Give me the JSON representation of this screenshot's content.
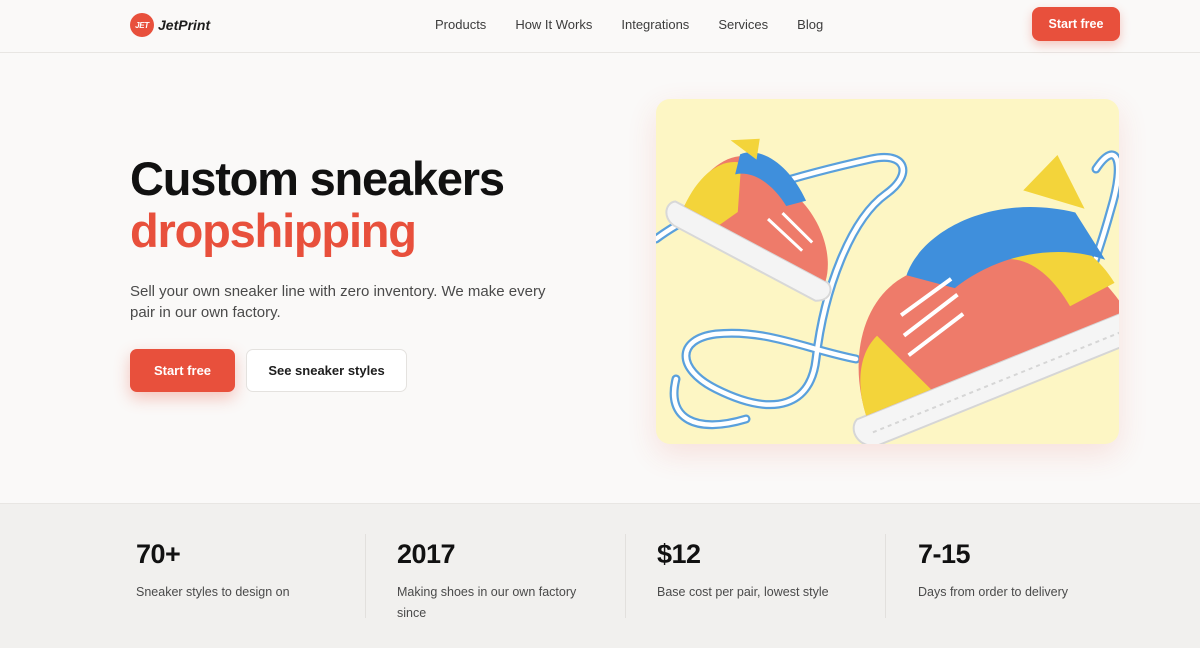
{
  "brand": {
    "name": "JetPrint",
    "mark": "JET"
  },
  "nav": {
    "items": [
      "Products",
      "How It Works",
      "Integrations",
      "Services",
      "Blog"
    ],
    "cta": "Start free"
  },
  "hero": {
    "title_line1": "Custom sneakers",
    "title_line2": "dropshipping",
    "description": "Sell your own sneaker line with zero inventory. We make every pair in our own factory.",
    "primary_cta": "Start free",
    "secondary_cta": "See sneaker styles"
  },
  "stats": [
    {
      "value": "70+",
      "label": "Sneaker styles to design on"
    },
    {
      "value": "2017",
      "label": "Making shoes in our own factory since"
    },
    {
      "value": "$12",
      "label": "Base cost per pair, lowest style"
    },
    {
      "value": "7-15",
      "label": "Days from order to delivery"
    }
  ],
  "colors": {
    "accent": "#e8503c",
    "hero_bg": "#fdf6c4",
    "page_bg": "#faf9f8",
    "stats_bg": "#f1f0ee"
  },
  "icons": {
    "logo": "jet-logo-icon"
  }
}
